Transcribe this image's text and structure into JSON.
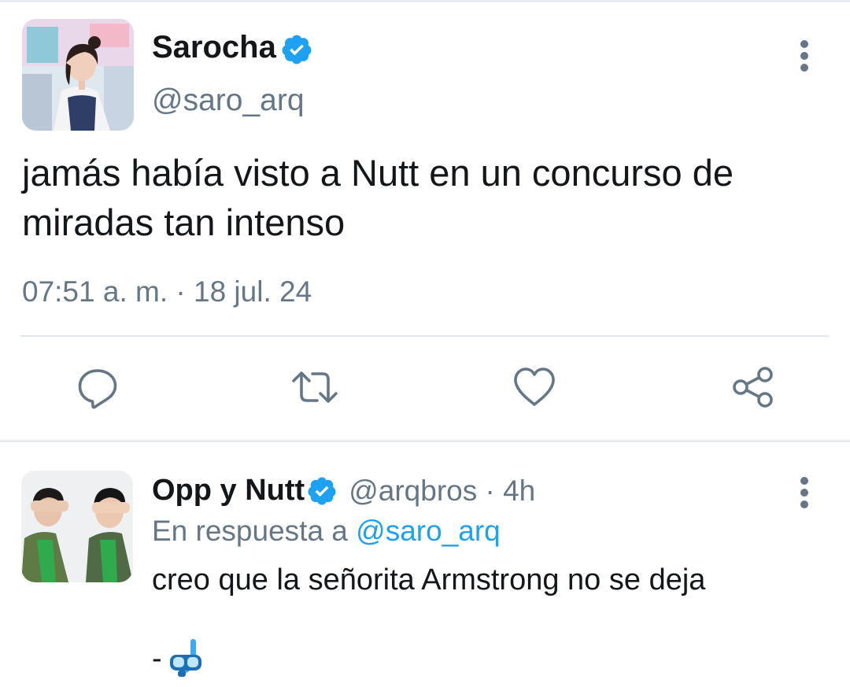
{
  "main_tweet": {
    "display_name": "Sarocha",
    "handle": "@saro_arq",
    "text": "jamás había visto a Nutt en un concurso de miradas tan intenso",
    "timestamp": "07:51 a. m. · 18 jul. 24",
    "avatar_icon": "profile-photo",
    "verified_icon": "verified-badge-icon",
    "more_icon": "more-vertical-icon",
    "actions": [
      "reply-icon",
      "retweet-icon",
      "like-icon",
      "share-icon"
    ]
  },
  "reply_tweet": {
    "display_name": "Opp y Nutt",
    "handle": "@arqbros",
    "time": " · 4h",
    "reply_prefix": "En respuesta a ",
    "reply_to_handle": "@saro_arq",
    "text": "creo que la señorita Armstrong no se deja",
    "sign_prefix": "-",
    "sign_icon": "diving-mask-icon"
  },
  "colors": {
    "verified_blue": "#1da1f2",
    "secondary_text": "#657786",
    "primary_text": "#14171a",
    "divider": "#e1e8ed"
  }
}
